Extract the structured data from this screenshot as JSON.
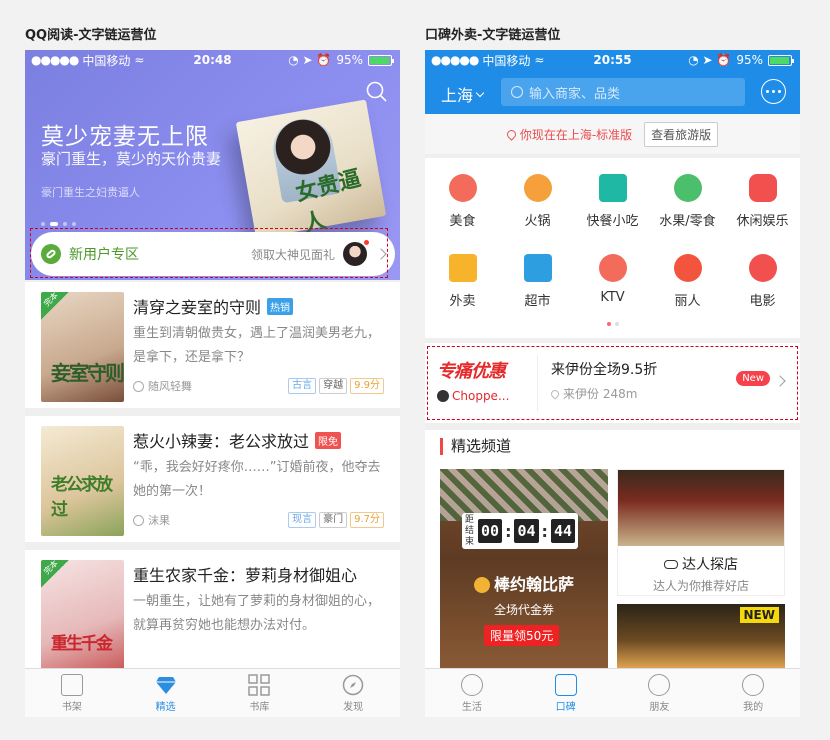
{
  "left": {
    "caption": "QQ阅读-文字链运营位",
    "status": {
      "carrier": "中国移动",
      "time": "20:48",
      "battery": "95%"
    },
    "hero": {
      "title": "莫少宠妻无上限",
      "subtitle": "豪门重生，莫少的天价贵妻",
      "sub2": "豪门重生之妇贵逼人",
      "cover_title": "女贵逼人"
    },
    "newuser": {
      "label": "新用户专区",
      "right_text": "领取大神见面礼"
    },
    "books": [
      {
        "badge": "完本",
        "cover_title": "妾室守则",
        "title": "清穿之妾室的守则",
        "tag": "热销",
        "tag_color": "#3aa0e8",
        "desc": "重生到清朝做贵女，遇上了温润美男老九，是拿下，还是拿下？",
        "author": "随风轻舞",
        "tags": [
          "古言",
          "穿越",
          "9.9分"
        ]
      },
      {
        "badge": "",
        "cover_title": "老公求放过",
        "title": "惹火小辣妻：老公求放过",
        "tag": "限免",
        "tag_color": "#f05252",
        "desc": "“乖，我会好好疼你……”订婚前夜，他夺去她的第一次！",
        "author": "沫果",
        "tags": [
          "现言",
          "豪门",
          "9.7分"
        ]
      },
      {
        "badge": "完本",
        "cover_title": "重生千金",
        "title": "重生农家千金：萝莉身材御姐心",
        "tag": "",
        "tag_color": "",
        "desc": "一朝重生，让她有了萝莉的身材御姐的心，就算再贫穷她也能想办法对付。",
        "author": "",
        "tags": []
      }
    ],
    "tabs": [
      "书架",
      "精选",
      "书库",
      "发现"
    ]
  },
  "right": {
    "caption": "口碑外卖-文字链运营位",
    "status": {
      "carrier": "中国移动",
      "time": "20:55",
      "battery": "95%"
    },
    "city": "上海",
    "search_placeholder": "输入商家、品类",
    "location": {
      "text": "你现在在上海-标准版",
      "button": "查看旅游版"
    },
    "categories": [
      {
        "label": "美食",
        "color": "#f26b5b"
      },
      {
        "label": "火锅",
        "color": "#f5a03a"
      },
      {
        "label": "快餐小吃",
        "color": "#1fb8a4"
      },
      {
        "label": "水果/零食",
        "color": "#4cbf6d"
      },
      {
        "label": "休闲娱乐",
        "color": "#f24f4f"
      },
      {
        "label": "外卖",
        "color": "#f7b32b"
      },
      {
        "label": "超市",
        "color": "#2d9ee0"
      },
      {
        "label": "KTV",
        "color": "#f26b5b"
      },
      {
        "label": "丽人",
        "color": "#f2543d"
      },
      {
        "label": "电影",
        "color": "#f24f4f"
      }
    ],
    "promo": {
      "logo": "专痛优惠",
      "logo_sub": "Choppe...",
      "title": "来伊份全场9.5折",
      "sub": "来伊份 248m",
      "badge": "New"
    },
    "featured": {
      "title": "精选频道",
      "countdown": {
        "label": "距结束",
        "h": "00",
        "m": "04",
        "s": "44"
      },
      "f1_name": "棒约翰比萨",
      "f1_sub": "全场代金券",
      "f1_btn": "限量领50元",
      "f2_title": "达人探店",
      "f2_sub": "达人为你推荐好店",
      "f3_badge": "NEW"
    },
    "tabs": [
      "生活",
      "口碑",
      "朋友",
      "我的"
    ]
  }
}
